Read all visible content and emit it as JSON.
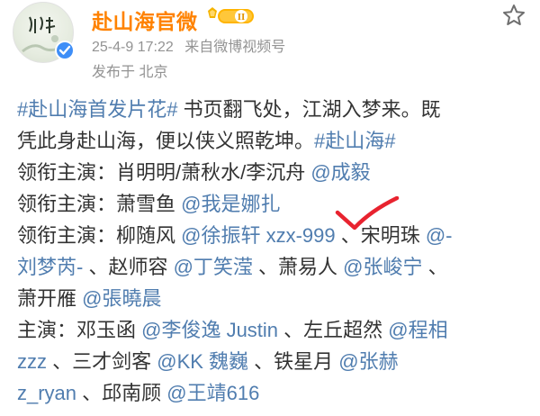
{
  "post": {
    "author": "赴山海官微",
    "vip_level": "II",
    "timestamp": "25-4-9 17:22",
    "source": "来自微博视频号",
    "location": "发布于 北京"
  },
  "icons": {
    "avatar": "profile-avatar",
    "verified": "verified-badge-icon",
    "vip": "vip-level-badge-icon",
    "star": "favorite-star-icon",
    "check": "red-checkmark-annotation"
  },
  "colors": {
    "name": "#ff8200",
    "link": "#507daf",
    "meta": "#939393",
    "check": "#e8232f"
  },
  "content": {
    "l1": {
      "tag1": "#赴山海首发片花#",
      "text": " 书页翻飞处，江湖入梦来。既"
    },
    "l2": {
      "text": "凭此身赴山海，便以侠义照乾坤。",
      "tag2": "#赴山海#"
    },
    "l3": {
      "prefix": "领衔主演：肖明明/萧秋水/李沉舟 ",
      "m1": "@成毅"
    },
    "l4": {
      "prefix": "领衔主演：萧雪鱼 ",
      "m2": "@我是娜扎"
    },
    "l5": {
      "prefix": "领衔主演：柳随风 ",
      "m3": "@徐振轩 xzx-999",
      "mid": " 、宋明珠 ",
      "m4a": "@-"
    },
    "l6": {
      "m4b": "刘梦芮-",
      "t1": " 、赵师容 ",
      "m5": "@丁笑滢",
      "t2": " 、萧易人 ",
      "m6": "@张峻宁",
      "t3": " 、"
    },
    "l7": {
      "prefix": "萧开雁 ",
      "m7": "@張曉晨"
    },
    "l8": {
      "prefix": "主演：邓玉函 ",
      "m8": "@李俊逸 Justin",
      "t1": " 、左丘超然 ",
      "m9a": "@程相"
    },
    "l9": {
      "m9b": "zzz",
      "t1": " 、三才剑客 ",
      "m10": "@KK 魏巍",
      "t2": " 、铁星月 ",
      "m11a": "@张赫"
    },
    "l10": {
      "m11b": "z_ryan",
      "t1": " 、邱南顾 ",
      "m12": "@王靖616"
    }
  }
}
